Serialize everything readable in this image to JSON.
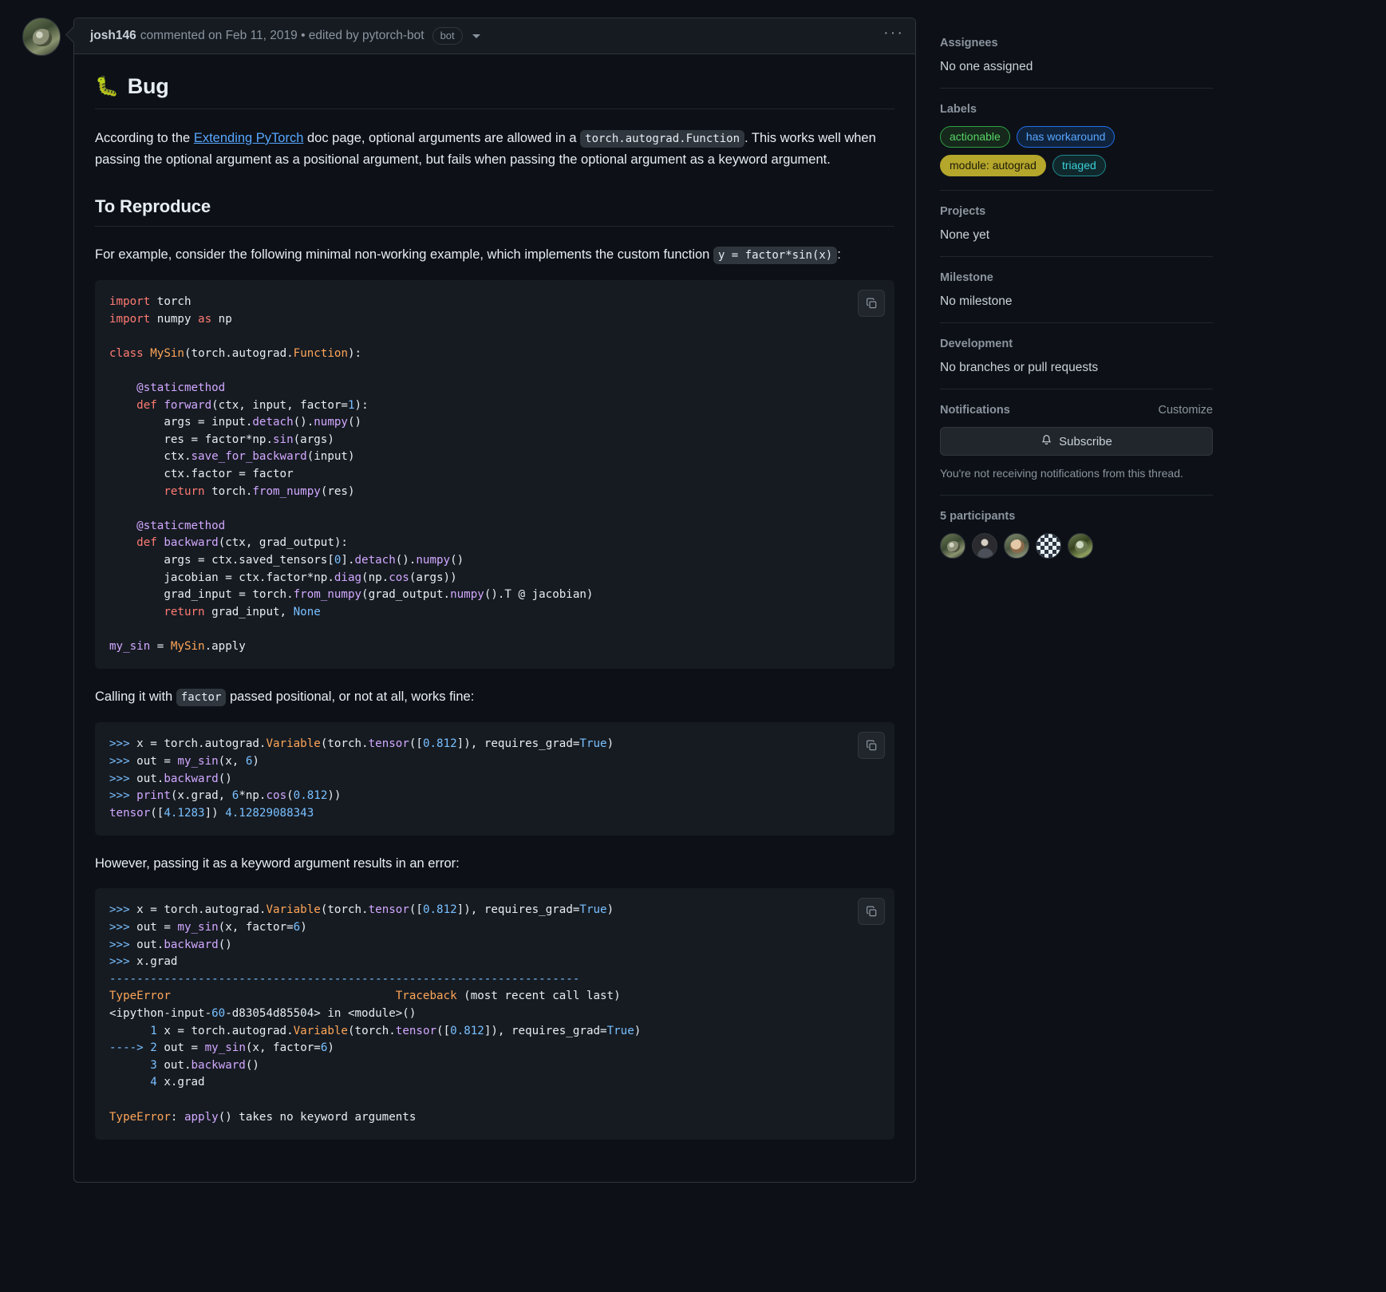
{
  "comment": {
    "author": "josh146",
    "meta": "commented on Feb 11, 2019 • edited by pytorch-bot",
    "bot_badge": "bot",
    "kebab": "···"
  },
  "content": {
    "bug_emoji": "🐛",
    "bug_heading": "Bug",
    "intro_1": "According to the ",
    "intro_link": "Extending PyTorch",
    "intro_2": " doc page, optional arguments are allowed in a ",
    "intro_code": "torch.autograd.Function",
    "intro_3": ". This works well when passing the optional argument as a positional argument, but fails when passing the optional argument as a keyword argument.",
    "repro_heading": "To Reproduce",
    "repro_1": "For example, consider the following minimal non-working example, which implements the custom function ",
    "repro_code": "y = factor*sin(x)",
    "repro_2": ":",
    "calling_1": "Calling it with ",
    "calling_code": "factor",
    "calling_2": " passed positional, or not at all, works fine:",
    "however": "However, passing it as a keyword argument results in an error:"
  },
  "code_blocks": {
    "block1_lines": [
      "import torch",
      "import numpy as np",
      "",
      "class MySin(torch.autograd.Function):",
      "",
      "    @staticmethod",
      "    def forward(ctx, input, factor=1):",
      "        args = input.detach().numpy()",
      "        res = factor*np.sin(args)",
      "        ctx.save_for_backward(input)",
      "        ctx.factor = factor",
      "        return torch.from_numpy(res)",
      "",
      "    @staticmethod",
      "    def backward(ctx, grad_output):",
      "        args = ctx.saved_tensors[0].detach().numpy()",
      "        jacobian = ctx.factor*np.diag(np.cos(args))",
      "        grad_input = torch.from_numpy(grad_output.numpy().T @ jacobian)",
      "        return grad_input, None",
      "",
      "my_sin = MySin.apply"
    ],
    "block2_lines": [
      ">>> x = torch.autograd.Variable(torch.tensor([0.812]), requires_grad=True)",
      ">>> out = my_sin(x, 6)",
      ">>> out.backward()",
      ">>> print(x.grad, 6*np.cos(0.812))",
      "tensor([4.1283]) 4.12829088343"
    ],
    "block3_lines": [
      ">>> x = torch.autograd.Variable(torch.tensor([0.812]), requires_grad=True)",
      ">>> out = my_sin(x, factor=6)",
      ">>> out.backward()",
      ">>> x.grad",
      "---------------------------------------------------------------------",
      "TypeError                                 Traceback (most recent call last)",
      "<ipython-input-60-d83054d85504> in <module>()",
      "      1 x = torch.autograd.Variable(torch.tensor([0.812]), requires_grad=True)",
      "----> 2 out = my_sin(x, factor=6)",
      "      3 out.backward()",
      "      4 x.grad",
      "",
      "TypeError: apply() takes no keyword arguments"
    ]
  },
  "sidebar": {
    "assignees": {
      "title": "Assignees",
      "value": "No one assigned"
    },
    "labels": {
      "title": "Labels",
      "items": [
        {
          "name": "actionable",
          "text_color": "#56d364",
          "border_color": "#2ea043",
          "bg_color": "#16281c"
        },
        {
          "name": "has workaround",
          "text_color": "#58a6ff",
          "border_color": "#1f6feb",
          "bg_color": "#10233d"
        },
        {
          "name": "module: autograd",
          "text_color": "#1c1a08",
          "border_color": "#b5a62c",
          "bg_color": "#b5a62c"
        },
        {
          "name": "triaged",
          "text_color": "#39d0d8",
          "border_color": "#1f8a8f",
          "bg_color": "#10282c"
        }
      ]
    },
    "projects": {
      "title": "Projects",
      "value": "None yet"
    },
    "milestone": {
      "title": "Milestone",
      "value": "No milestone"
    },
    "development": {
      "title": "Development",
      "value": "No branches or pull requests"
    },
    "notifications": {
      "title": "Notifications",
      "customize": "Customize",
      "subscribe_label": "Subscribe",
      "note": "You're not receiving notifications from this thread."
    },
    "participants": {
      "title": "5 participants",
      "count": 5
    }
  }
}
